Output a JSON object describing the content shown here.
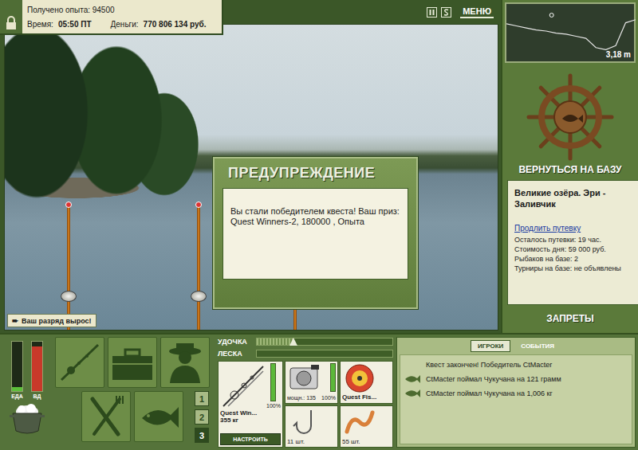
{
  "header": {
    "experience": "Получено опыта: 94500",
    "time_label": "Время:",
    "time": "05:50 ПТ",
    "money_label": "Деньги:",
    "money": "770 806 134 руб.",
    "locked": true,
    "menu": "МЕНЮ"
  },
  "depth": {
    "reading": "3,18 m",
    "position": 0.35,
    "profile": [
      1.3,
      1.5,
      1.7,
      1.9,
      2.0,
      2.2,
      2.3,
      2.5,
      2.7,
      3.6,
      3.8,
      3.4,
      1.2,
      0.9
    ]
  },
  "base": {
    "return": "ВЕРНУТЬСЯ НА БАЗУ",
    "location": "Великие озёра. Эри - Заливчик",
    "extend": "Продлить путевку",
    "lines": [
      "Осталось путевки: 19 час.",
      "Стоимость дня: 59 000 руб.",
      "Рыбаков на базе: 2",
      "Турниры на базе: не объявлены"
    ],
    "bans": "ЗАПРЕТЫ"
  },
  "dialog": {
    "title": "ПРЕДУПРЕЖДЕНИЕ",
    "message": "Вы стали победителем квеста! Ваш приз: Quest Winners-2, 180000 , Опыта"
  },
  "toast": {
    "icon": "➨",
    "text": "Ваш разряд вырос!"
  },
  "stats": [
    {
      "label": "ЕДА",
      "level": 0.08,
      "color": "#5cbf3a"
    },
    {
      "label": "ВД",
      "level": 0.9,
      "color": "#c8392a"
    }
  ],
  "slots": [
    {
      "number": "1",
      "selected": false
    },
    {
      "number": "2",
      "selected": false
    },
    {
      "number": "3",
      "selected": true
    }
  ],
  "tension": [
    {
      "label": "УДОЧКА",
      "level": 0.27
    },
    {
      "label": "ЛЕСКА",
      "level": 0
    }
  ],
  "tackle": {
    "rod": {
      "name": "Quest Win...",
      "weight": "355 кг",
      "condition": "100%",
      "level": 1
    },
    "reel": {
      "power": "мощн.: 135",
      "condition": "100%",
      "level": 1
    },
    "line": {
      "name": "Quest Fis..."
    },
    "hook": {
      "count": "11 шт."
    },
    "bait": {
      "count": "55 шт."
    },
    "setup": "НАСТРОИТЬ"
  },
  "tabs": [
    {
      "label": "ИГРОКИ",
      "selected": true
    },
    {
      "label": "СОБЫТИЯ",
      "selected": false
    }
  ],
  "events": [
    {
      "kind": "notice",
      "text": "Квест закончен! Победитель CtMacter"
    },
    {
      "kind": "catch",
      "text": "CtMacter поймал Чукучана на 121 грамм"
    },
    {
      "kind": "catch",
      "text": "CtMacter поймал Чукучана на 1,006 кг"
    }
  ]
}
